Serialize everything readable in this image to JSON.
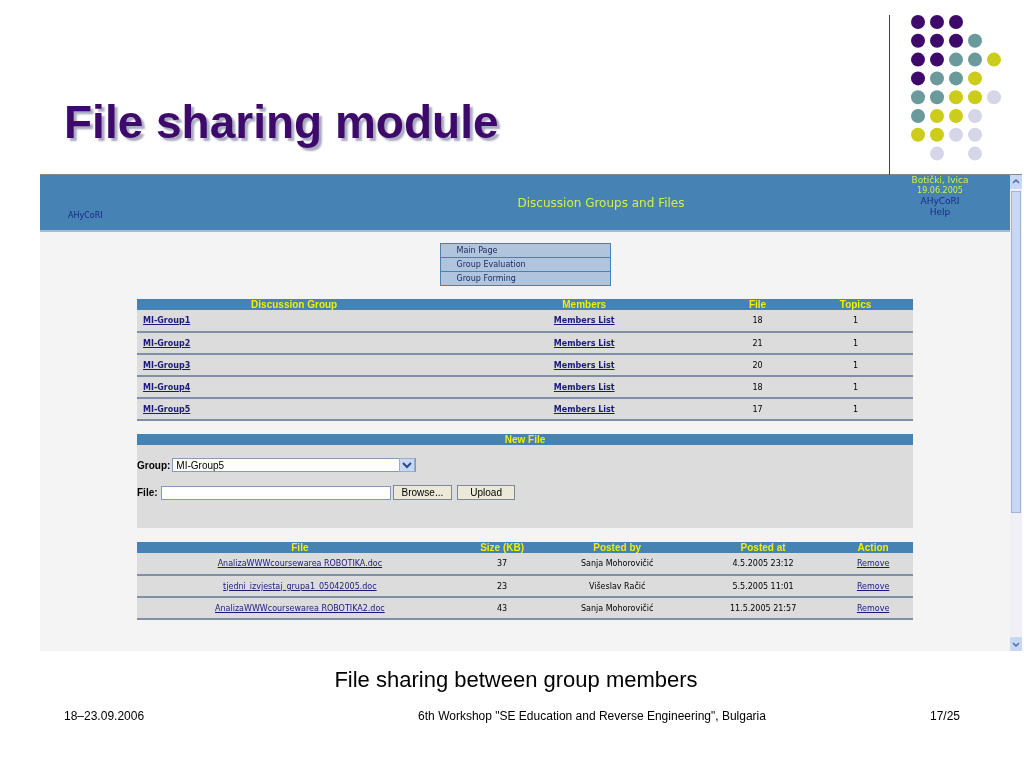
{
  "slide": {
    "title": "File sharing module",
    "caption": "File sharing between group members",
    "footer_left": "18–23.09.2006",
    "footer_center": "6th Workshop \"SE Education and Reverse Engineering\", Bulgaria",
    "footer_right": "17/25"
  },
  "app": {
    "header": {
      "app_name": "AHyCoRI",
      "title": "Discussion Groups and Files",
      "user": "Botički, Ivica",
      "date": "19.06.2005",
      "app_link": "AHyCoRI",
      "help": "Help"
    },
    "menu": [
      "Main Page",
      "Group Evaluation",
      "Group Forming"
    ],
    "groups_table": {
      "columns": [
        "Discussion Group",
        "Members",
        "File",
        "Topics"
      ],
      "rows": [
        {
          "group": "MI-Group1",
          "members": "Members List",
          "file": "18",
          "topics": "1"
        },
        {
          "group": "MI-Group2",
          "members": "Members List",
          "file": "21",
          "topics": "1"
        },
        {
          "group": "MI-Group3",
          "members": "Members List",
          "file": "20",
          "topics": "1"
        },
        {
          "group": "MI-Group4",
          "members": "Members List",
          "file": "18",
          "topics": "1"
        },
        {
          "group": "MI-Group5",
          "members": "Members List",
          "file": "17",
          "topics": "1"
        }
      ]
    },
    "new_file": {
      "title": "New File",
      "group_label": "Group:",
      "group_value": "MI-Group5",
      "file_label": "File:",
      "browse": "Browse...",
      "upload": "Upload"
    },
    "files_table": {
      "columns": [
        "File",
        "Size (KB)",
        "Posted by",
        "Posted at",
        "Action"
      ],
      "rows": [
        {
          "file": "AnalizaWWWcoursewarea ROBOTIKA.doc",
          "size": "37",
          "posted_by": "Sanja Mohorovičić",
          "posted_at": "4.5.2005 23:12",
          "action": "Remove"
        },
        {
          "file": "tjedni_izvjestaj_grupa1_05042005.doc",
          "size": "23",
          "posted_by": "Višeslav Račić",
          "posted_at": "5.5.2005 11:01",
          "action": "Remove"
        },
        {
          "file": "AnalizaWWWcoursewarea ROBOTIKA2.doc",
          "size": "43",
          "posted_by": "Sanja Mohorovičić",
          "posted_at": "11.5.2005 21:57",
          "action": "Remove"
        }
      ]
    }
  }
}
